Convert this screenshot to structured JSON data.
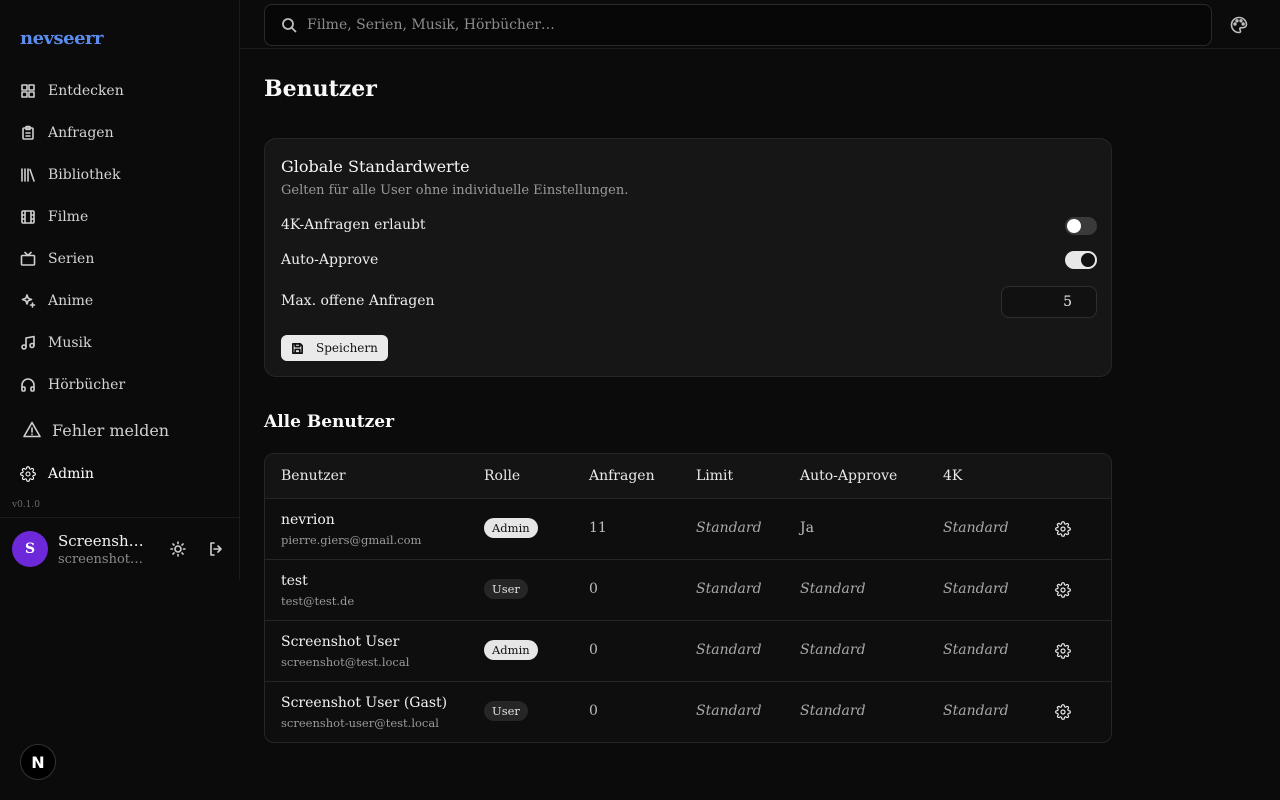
{
  "app": {
    "logo": "nevseerr",
    "version": "v0.1.0"
  },
  "sidebar": {
    "items": [
      {
        "label": "Entdecken",
        "icon": "grid-icon"
      },
      {
        "label": "Anfragen",
        "icon": "clipboard-icon"
      },
      {
        "label": "Bibliothek",
        "icon": "library-icon"
      },
      {
        "label": "Filme",
        "icon": "film-icon"
      },
      {
        "label": "Serien",
        "icon": "tv-icon"
      },
      {
        "label": "Anime",
        "icon": "sparkles-icon"
      },
      {
        "label": "Musik",
        "icon": "music-icon"
      },
      {
        "label": "Hörbücher",
        "icon": "headphones-icon"
      }
    ],
    "report_label": "Fehler melden",
    "admin_label": "Admin"
  },
  "user": {
    "initial": "S",
    "name": "Screenshot …",
    "email": "screenshot@t…"
  },
  "search": {
    "placeholder": "Filme, Serien, Musik, Hörbücher…"
  },
  "page": {
    "title": "Benutzer"
  },
  "defaults": {
    "title": "Globale Standardwerte",
    "subtitle": "Gelten für alle User ohne individuelle Einstellungen.",
    "k4_label": "4K-Anfragen erlaubt",
    "k4_enabled": false,
    "auto_label": "Auto-Approve",
    "auto_enabled": true,
    "max_label": "Max. offene Anfragen",
    "max_value": "5",
    "save_label": "Speichern"
  },
  "users": {
    "title": "Alle Benutzer",
    "columns": [
      "Benutzer",
      "Rolle",
      "Anfragen",
      "Limit",
      "Auto-Approve",
      "4K"
    ],
    "rows": [
      {
        "name": "nevrion",
        "email": "pierre.giers@gmail.com",
        "role": "Admin",
        "requests": "11",
        "limit": "Standard",
        "auto": "Ja",
        "k4": "Standard"
      },
      {
        "name": "test",
        "email": "test@test.de",
        "role": "User",
        "requests": "0",
        "limit": "Standard",
        "auto": "Standard",
        "k4": "Standard"
      },
      {
        "name": "Screenshot User",
        "email": "screenshot@test.local",
        "role": "Admin",
        "requests": "0",
        "limit": "Standard",
        "auto": "Standard",
        "k4": "Standard"
      },
      {
        "name": "Screenshot User (Gast)",
        "email": "screenshot-user@test.local",
        "role": "User",
        "requests": "0",
        "limit": "Standard",
        "auto": "Standard",
        "k4": "Standard"
      }
    ]
  },
  "dev_badge": "N",
  "colors": {
    "accent": "#5b8def",
    "avatar": "#6d28d9",
    "background": "#0b0b0b"
  }
}
